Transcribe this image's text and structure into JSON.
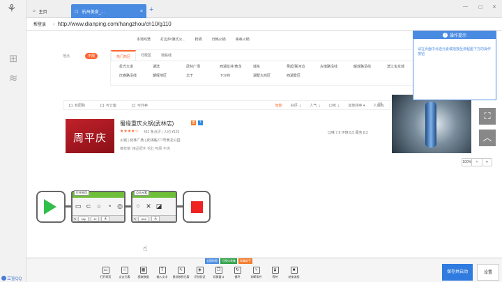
{
  "tabs": [
    {
      "label": "主页"
    },
    {
      "label": "杭州美食_..."
    }
  ],
  "addressbar": {
    "login": "帮登录",
    "url": "http://www.dianping.com/hangzhou/ch10/g110"
  },
  "web": {
    "top_row1": [
      "本地鸡煲",
      "打边炉/港式火...",
      "粉锅",
      "日韩火锅",
      "串串火锅"
    ],
    "loc_label": "地点",
    "loc_badge": "不限",
    "filter_tabs": [
      "热门商区",
      "行政区",
      "地铁线"
    ],
    "filter_items": [
      "星光大道",
      "湖滨",
      "武林广场",
      "西湖龙井/黄龙",
      "城东",
      "吴起/联河边",
      "古墩路沿线",
      "解放路沿线",
      "滨江宝龙城",
      "庆春路沿线",
      "朝晖地区",
      "北干",
      "下沙商",
      "湖墅大商区",
      "西湖景区"
    ],
    "sortbar": {
      "checks": [
        "有团购",
        "可订座",
        "可外卖"
      ],
      "sorts": [
        "智能",
        "好评 ⇣",
        "人气 ⇣",
        "口味 ⇣",
        "其他排序 ▾",
        "人均 ⇅"
      ]
    },
    "shop": {
      "img_text": "周平庆",
      "name": "蜀缘重庆火锅(武林店)",
      "stars": "★★★★☆",
      "reviews": "461 条点评",
      "avg": "人均 ¥123",
      "category": "火锅 | 武林广场 | 武林路277号黄龙公园",
      "recommend": "推荐菜: 精品肥牛  毛肚  鸭肠  牛肉",
      "scores": "口味 7.9   环境 8.5   服务 8.2"
    },
    "tip": {
      "title": "操作提示",
      "text": "请在页面中点选元素或拖拽至流程图下方的操作按钮"
    }
  },
  "canvas": {
    "zoom": "100%",
    "blocks": [
      {
        "title": "打开网页",
        "bottom": [
          "http",
          "10",
          "无"
        ]
      },
      {
        "title": "点击元素",
        "bottom": [
          "click",
          "无"
        ]
      }
    ]
  },
  "bottombar": {
    "tags": [
      "全国地图",
      "可视化采集",
      "采集助手"
    ],
    "tags_colors": [
      "#4a8be2",
      "#2fa14a",
      "#f37b2a"
    ],
    "tools": [
      "打开网页",
      "点击元素",
      "提取数据",
      "输入文字",
      "鼠标移到元素",
      "识别验证",
      "切换窗口",
      "循环",
      "判断条件",
      "等待",
      "结束流程"
    ],
    "save": "保存并启动",
    "settings": "设置"
  },
  "user": {
    "name": "立宣QQ"
  }
}
